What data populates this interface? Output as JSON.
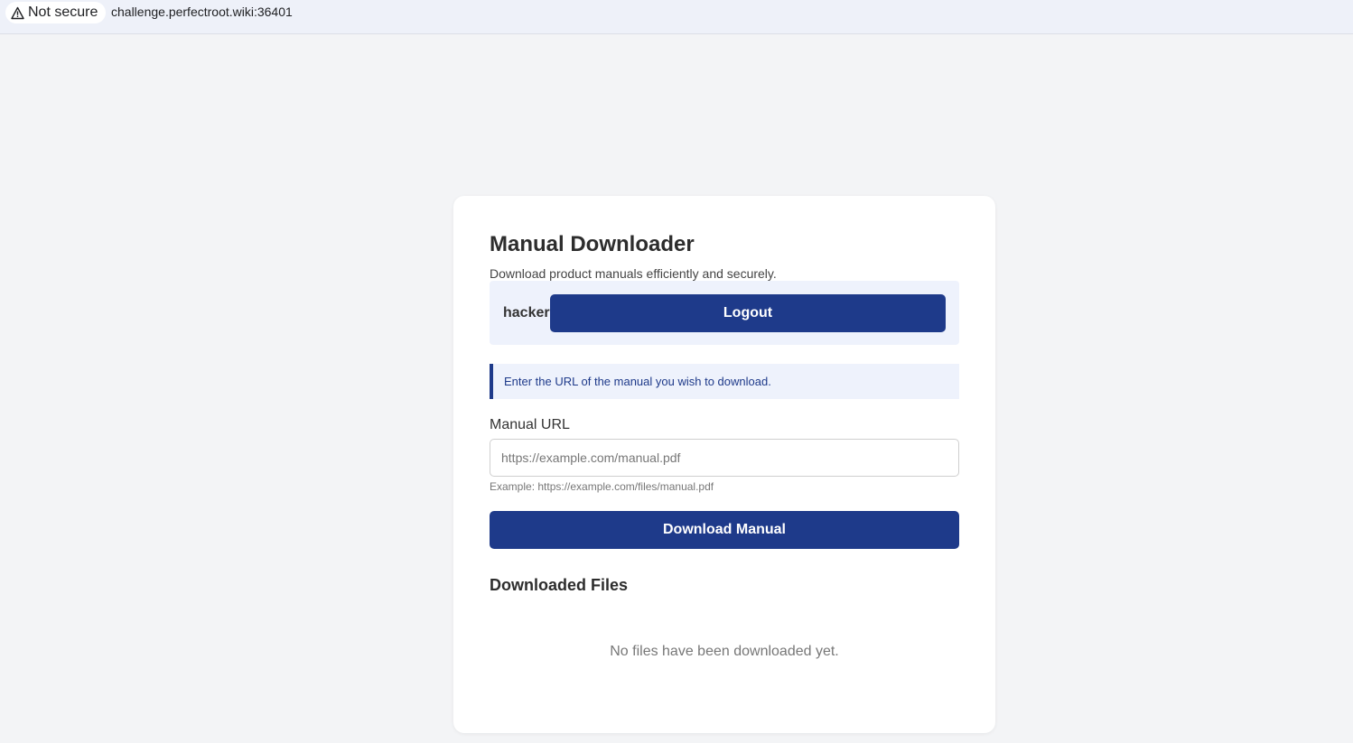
{
  "browser": {
    "security_label": "Not secure",
    "security_icon": "warning-triangle-icon",
    "url": "challenge.perfectroot.wiki:36401"
  },
  "app": {
    "title": "Manual Downloader",
    "subtitle": "Download product manuals efficiently and securely.",
    "user": {
      "username": "hacker",
      "logout_label": "Logout"
    },
    "info_message": "Enter the URL of the manual you wish to download.",
    "form": {
      "label": "Manual URL",
      "value": "",
      "placeholder": "https://example.com/manual.pdf",
      "hint": "Example: https://example.com/files/manual.pdf",
      "submit_label": "Download Manual"
    },
    "downloads": {
      "title": "Downloaded Files",
      "empty_message": "No files have been downloaded yet."
    }
  },
  "colors": {
    "primary": "#1e3a8a",
    "page_background": "#f3f4f6",
    "panel_background": "#eef2fc"
  }
}
